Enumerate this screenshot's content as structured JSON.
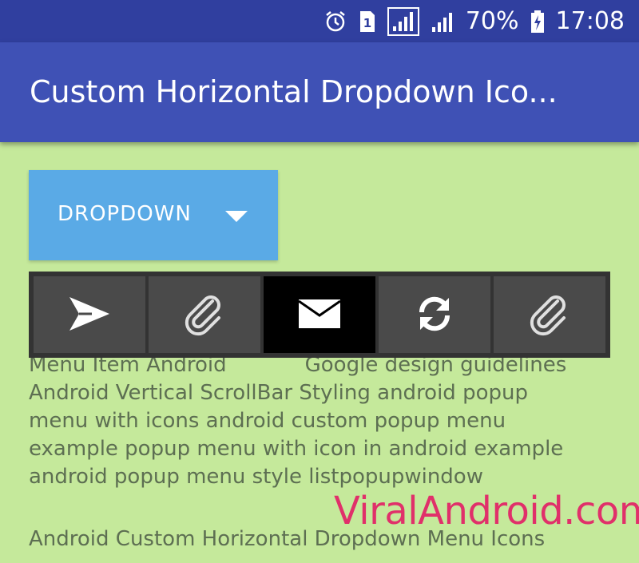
{
  "status_bar": {
    "icons": [
      "alarm-icon",
      "sim-1-icon",
      "signal-sim1-icon",
      "signal-sim2-icon",
      "battery-charging-icon"
    ],
    "battery_percent": "70%",
    "time": "17:08"
  },
  "app_bar": {
    "title": "Custom Horizontal Dropdown Ico..."
  },
  "dropdown": {
    "label": "DROPDOWN",
    "icon": "triangle-down-icon"
  },
  "toolbar": {
    "items": [
      {
        "icon": "send-icon",
        "active": false
      },
      {
        "icon": "attachment-icon",
        "active": false
      },
      {
        "icon": "mail-icon",
        "active": true
      },
      {
        "icon": "refresh-icon",
        "active": false
      },
      {
        "icon": "attachment-icon",
        "active": false
      }
    ]
  },
  "content": {
    "line1_left": "Menu Item Android",
    "line1_right": "Google design guidelines",
    "line2": "Android Vertical ScrollBar Styling android popup",
    "line3": "menu with icons android custom popup menu",
    "line4": "example popup menu with icon in android example",
    "line5": "android popup menu style listpopupwindow",
    "footer": "Android Custom Horizontal Dropdown Menu Icons"
  },
  "watermark": "ViralAndroid.com"
}
